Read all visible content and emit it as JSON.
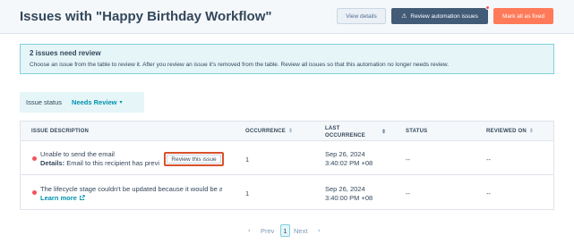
{
  "header": {
    "title": "Issues with \"Happy Birthday Workflow\"",
    "view_details": "View details",
    "review_automation": "Review automation issues",
    "mark_fixed": "Mark all as fixed"
  },
  "alert": {
    "title": "2 issues need review",
    "body": "Choose an issue from the table to review it. After you review an issue it's removed from the table. Review all issues so that this automation no longer needs review."
  },
  "filter": {
    "label": "Issue status",
    "value": "Needs Review"
  },
  "table": {
    "columns": {
      "description": "ISSUE DESCRIPTION",
      "occurrence": "OCCURRENCE",
      "last_occurrence_1": "LAST",
      "last_occurrence_2": "OCCURRENCE",
      "status": "STATUS",
      "reviewed_on": "REVIEWED ON"
    },
    "rows": [
      {
        "title": "Unable to send the email",
        "details_label": "Details:",
        "details_text": "Email to this recipient has previously bounced",
        "review_button": "Review this issue",
        "occurrence": "1",
        "date": "Sep 26, 2024",
        "time": "3:40:02 PM +08",
        "status": "--",
        "reviewed_on": "--"
      },
      {
        "title": "The lifecycle stage couldn't be updated because it would be a backward move",
        "learn_more": "Learn more",
        "occurrence": "1",
        "date": "Sep 26, 2024",
        "time": "3:40:00 PM +08",
        "status": "--",
        "reviewed_on": "--"
      }
    ]
  },
  "pagination": {
    "prev": "Prev",
    "current": "1",
    "next": "Next"
  },
  "colors": {
    "accent": "#0091ae",
    "primary_dark": "#425b76",
    "orange": "#ff7a59",
    "error_dot": "#f2545b",
    "alert_bg": "#e5f5f8"
  }
}
